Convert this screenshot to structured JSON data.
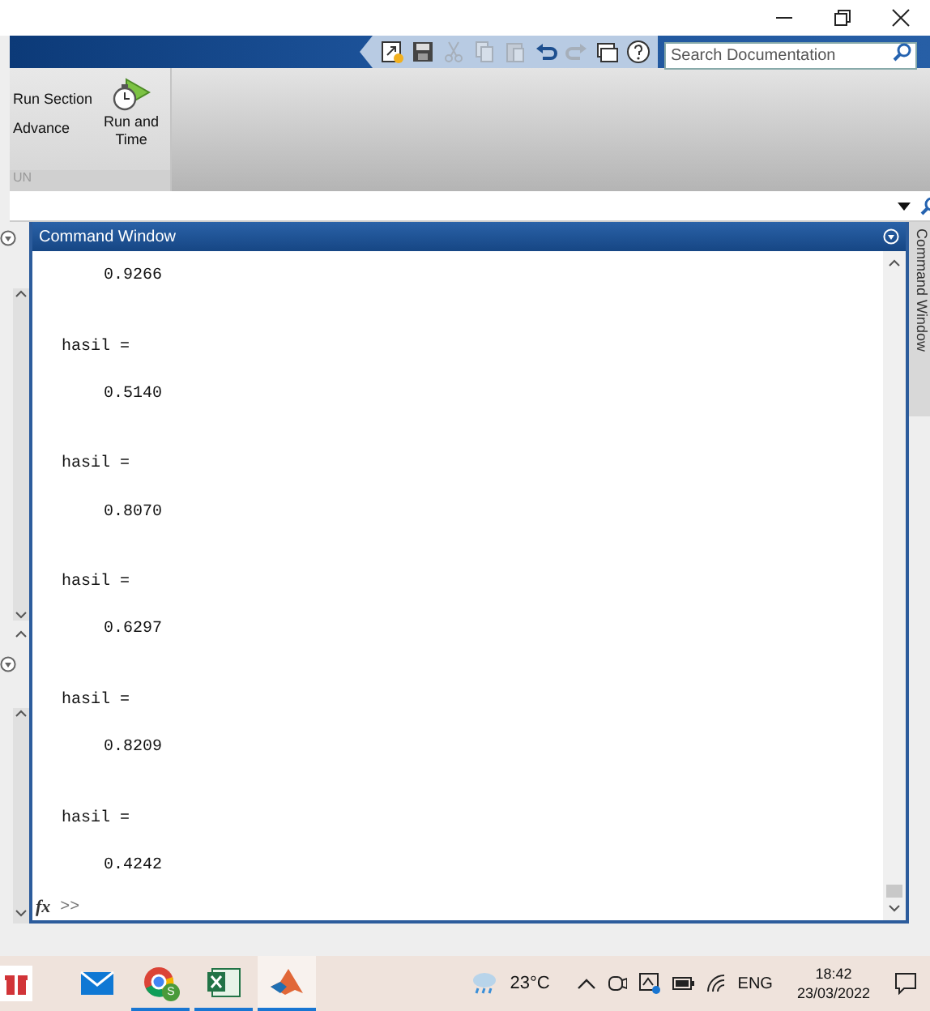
{
  "toolbar": {
    "tools": [
      {
        "kind": "shortcut",
        "disabled": false
      },
      {
        "kind": "save",
        "disabled": false
      },
      {
        "kind": "cut",
        "disabled": true
      },
      {
        "kind": "copy",
        "disabled": true
      },
      {
        "kind": "paste",
        "disabled": true
      },
      {
        "kind": "undo",
        "disabled": false
      },
      {
        "kind": "redo",
        "disabled": true
      },
      {
        "kind": "windows",
        "disabled": false
      },
      {
        "kind": "help",
        "disabled": false
      }
    ],
    "search": {
      "placeholder": "Search Documentation"
    }
  },
  "ribbon": {
    "items": [
      {
        "label": "Run Section"
      },
      {
        "label": "Advance"
      }
    ],
    "run_and_time": {
      "label": "Run and Time"
    },
    "section_label": "UN"
  },
  "command_window": {
    "title": "Command Window",
    "lines": [
      {
        "kind": "value",
        "text": "0.9266"
      },
      {
        "kind": "assign",
        "text": "hasil ="
      },
      {
        "kind": "value",
        "text": "0.5140"
      },
      {
        "kind": "assign",
        "text": "hasil ="
      },
      {
        "kind": "value",
        "text": "0.8070"
      },
      {
        "kind": "assign",
        "text": "hasil ="
      },
      {
        "kind": "value",
        "text": "0.6297"
      },
      {
        "kind": "assign",
        "text": "hasil ="
      },
      {
        "kind": "value",
        "text": "0.8209"
      },
      {
        "kind": "assign",
        "text": "hasil ="
      },
      {
        "kind": "value",
        "text": "0.4242"
      }
    ],
    "function_label": "fx",
    "prompt": ">>"
  },
  "side_tab": {
    "label": "Command Window"
  },
  "taskbar": {
    "apps": [
      {
        "kind": "gift",
        "running": false,
        "active": false
      },
      {
        "kind": "mail",
        "running": false,
        "active": false
      },
      {
        "kind": "chrome",
        "running": true,
        "active": false,
        "badge": "S"
      },
      {
        "kind": "excel",
        "running": true,
        "active": false
      },
      {
        "kind": "matlab",
        "running": true,
        "active": true
      }
    ],
    "temperature": "23°C",
    "language": "ENG",
    "time": "18:42",
    "date": "23/03/2022"
  }
}
